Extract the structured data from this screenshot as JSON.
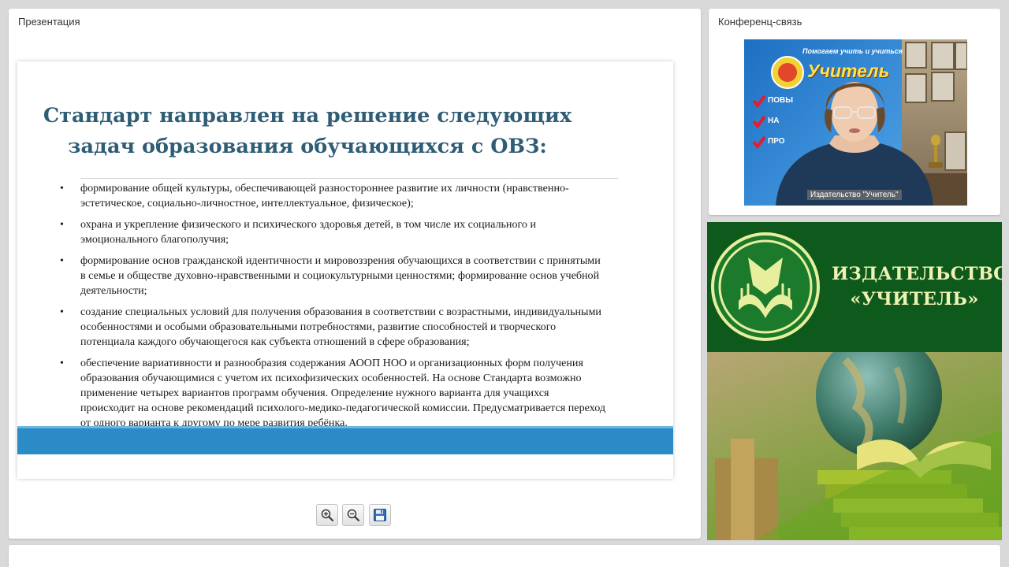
{
  "presentation": {
    "title": "Презентация",
    "slide": {
      "heading_line1": "Стандарт направлен на решение следующих",
      "heading_line2": "задач образования обучающихся с ОВЗ:",
      "bullet_glyph": "•",
      "items": [
        {
          "lines": [
            "формирование общей культуры, обеспечивающей разностороннее развитие их личности (нравственно-",
            "эстетическое, социально-личностное, интеллектуальное, физическое);"
          ]
        },
        {
          "lines": [
            "охрана и укрепление физического и психического здоровья детей, в том числе их социального и",
            "эмоционального благополучия;"
          ]
        },
        {
          "lines": [
            "формирование основ гражданской идентичности и мировоззрения обучающихся в соответствии с принятыми",
            "в семье и обществе духовно-нравственными и социокультурными ценностями; формирование основ учебной",
            "деятельности;"
          ]
        },
        {
          "lines": [
            "создание специальных условий для получения образования в соответствии с возрастными, индивидуальными",
            "особенностями и особыми образовательными потребностями, развитие способностей и творческого",
            "потенциала каждого обучающегося как субъекта отношений в сфере образования;"
          ]
        },
        {
          "lines": [
            "обеспечение вариативности и разнообразия содержания АООП НОО и организационных форм получения",
            "образования обучающимися с учетом их психофизических особенностей. На основе Стандарта возможно",
            "применение четырех вариантов программ обучения. Определение нужного варианта для учащихся",
            "происходит на основе рекомендаций психолого-медико-педагогической комиссии. Предусматривается переход",
            "от одного варианта к другому по мере развития ребёнка."
          ]
        }
      ],
      "band_color": "#2b8bc7",
      "heading_color": "#2e5d75"
    },
    "toolbar": {
      "zoom_in_icon": "zoom-in-icon",
      "zoom_out_icon": "zoom-out-icon",
      "save_icon": "save-icon"
    }
  },
  "conference": {
    "title": "Конференц-связь",
    "video": {
      "caption": "Издательство \"Учитель\"",
      "backdrop_top_text": "Помогаем учить и учиться",
      "backdrop_brand": "Учитель",
      "backdrop_text_1": "ПОВЫ",
      "backdrop_text_2": "НА",
      "backdrop_text_3": "ПРО"
    }
  },
  "publisher": {
    "name_line1": "ИЗДАТЕЛЬСТВО",
    "name_line2": "«УЧИТЕЛЬ»",
    "brand_green": "#0e5a1c",
    "name_color": "#f0f2b3"
  }
}
